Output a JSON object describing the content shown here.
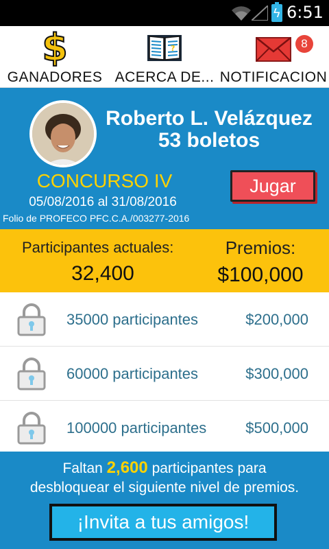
{
  "status_bar": {
    "time": "6:51"
  },
  "nav": {
    "items": [
      {
        "label": "GANADORES",
        "icon": "dollar-icon",
        "glyph": "$"
      },
      {
        "label": "ACERCA DE...",
        "icon": "book-icon"
      },
      {
        "label": "NOTIFICACION",
        "icon": "envelope-icon",
        "badge": "8"
      }
    ]
  },
  "profile": {
    "name": "Roberto L. Velázquez",
    "tickets": "53 boletos"
  },
  "contest": {
    "title": "CONCURSO IV",
    "dates": "05/08/2016 al 31/08/2016",
    "folio": "Folio de PROFECO PFC.C.A./003277-2016",
    "play_button": "Jugar"
  },
  "stats": {
    "participants_label": "Participantes actuales:",
    "participants_value": "32,400",
    "prizes_label": "Premios:",
    "prizes_value": "$100,000"
  },
  "levels": [
    {
      "participants": "35000 participantes",
      "prize": "$200,000"
    },
    {
      "participants": "60000 participantes",
      "prize": "$300,000"
    },
    {
      "participants": "100000 participantes",
      "prize": "$500,000"
    }
  ],
  "footer": {
    "msg_prefix": "Faltan ",
    "msg_highlight": "2,600",
    "msg_suffix": " participantes para",
    "msg_line2": "desbloquear el siguiente nivel de premios.",
    "invite_button": "¡Invita a tus amigos!"
  },
  "colors": {
    "primary_blue": "#1a8ac7",
    "accent_yellow": "#fcc20c",
    "play_red": "#ef4f58",
    "invite_blue": "#23b3e8"
  }
}
